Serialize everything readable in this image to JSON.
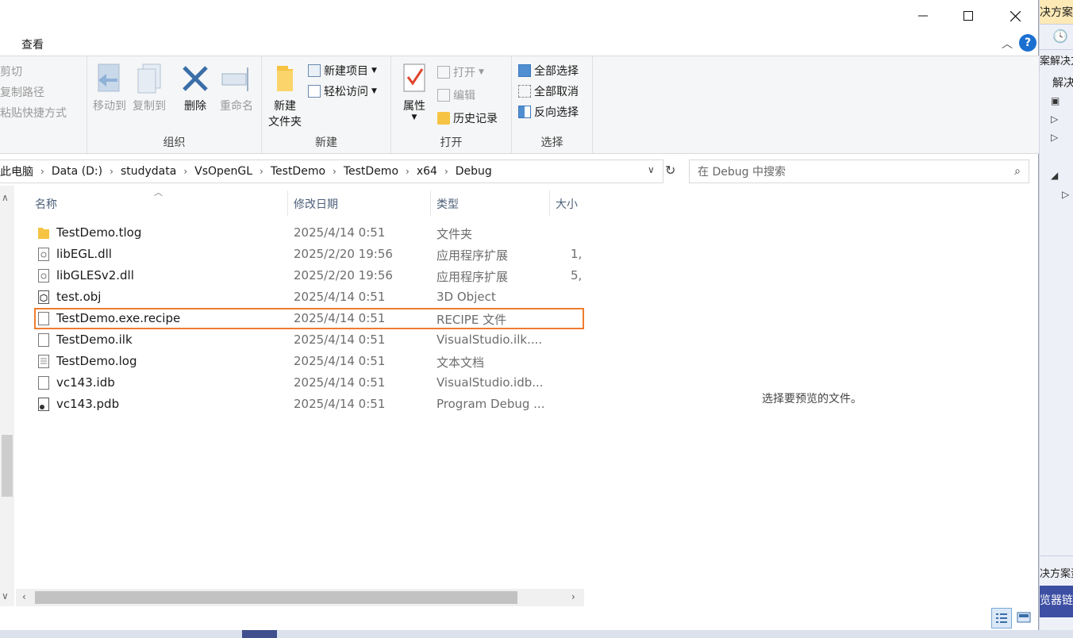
{
  "window": {
    "minimize_icon": "minimize-icon",
    "maximize_icon": "maximize-icon",
    "close_icon": "close-icon"
  },
  "tabs": {
    "view": "查看",
    "help": "?"
  },
  "ribbon": {
    "clipboard": {
      "cut": "剪切",
      "copy_path": "复制路径",
      "paste_shortcut": "粘贴快捷方式"
    },
    "organize": {
      "move_to": "移动到",
      "copy_to": "复制到",
      "delete": "删除",
      "rename": "重命名",
      "label": "组织"
    },
    "new": {
      "new_folder_line1": "新建",
      "new_folder_line2": "文件夹",
      "new_item": "新建项目",
      "easy_access": "轻松访问",
      "label": "新建"
    },
    "open": {
      "properties": "属性",
      "open": "打开",
      "edit": "编辑",
      "history": "历史记录",
      "label": "打开"
    },
    "select": {
      "select_all": "全部选择",
      "select_none": "全部取消",
      "invert": "反向选择",
      "label": "选择"
    }
  },
  "address": {
    "crumbs": [
      "此电脑",
      "Data (D:)",
      "studydata",
      "VsOpenGL",
      "TestDemo",
      "TestDemo",
      "x64",
      "Debug"
    ],
    "search_placeholder": "在 Debug 中搜索"
  },
  "columns": {
    "name": "名称",
    "date": "修改日期",
    "type": "类型",
    "size": "大小"
  },
  "files": [
    {
      "name": "TestDemo.tlog",
      "date": "2025/4/14 0:51",
      "type": "文件夹",
      "size": "",
      "icon": "folder-icon"
    },
    {
      "name": "libEGL.dll",
      "date": "2025/2/20 19:56",
      "type": "应用程序扩展",
      "size": "1,",
      "icon": "dll-icon"
    },
    {
      "name": "libGLESv2.dll",
      "date": "2025/2/20 19:56",
      "type": "应用程序扩展",
      "size": "5,",
      "icon": "dll-icon"
    },
    {
      "name": "test.obj",
      "date": "2025/4/14 0:51",
      "type": "3D Object",
      "size": "",
      "icon": "3d-object-icon"
    },
    {
      "name": "TestDemo.exe.recipe",
      "date": "2025/4/14 0:51",
      "type": "RECIPE 文件",
      "size": "",
      "icon": "file-icon"
    },
    {
      "name": "TestDemo.ilk",
      "date": "2025/4/14 0:51",
      "type": "VisualStudio.ilk....",
      "size": "",
      "icon": "file-icon"
    },
    {
      "name": "TestDemo.log",
      "date": "2025/4/14 0:51",
      "type": "文本文档",
      "size": "",
      "icon": "text-file-icon"
    },
    {
      "name": "vc143.idb",
      "date": "2025/4/14 0:51",
      "type": "VisualStudio.idb...",
      "size": "",
      "icon": "file-icon"
    },
    {
      "name": "vc143.pdb",
      "date": "2025/4/14 0:51",
      "type": "Program Debug ...",
      "size": "",
      "icon": "pdb-file-icon"
    }
  ],
  "highlighted_file": "TestDemo.exe.recipe",
  "highlight_color": "#ee7d2f",
  "preview": {
    "empty_text": "选择要预览的文件。"
  },
  "background_app": {
    "top_text": "决方案资",
    "solution_text": "案解决方",
    "solution_item": "解决",
    "bottom_text1": "决方案资",
    "bottom_text2": "览器链接"
  }
}
